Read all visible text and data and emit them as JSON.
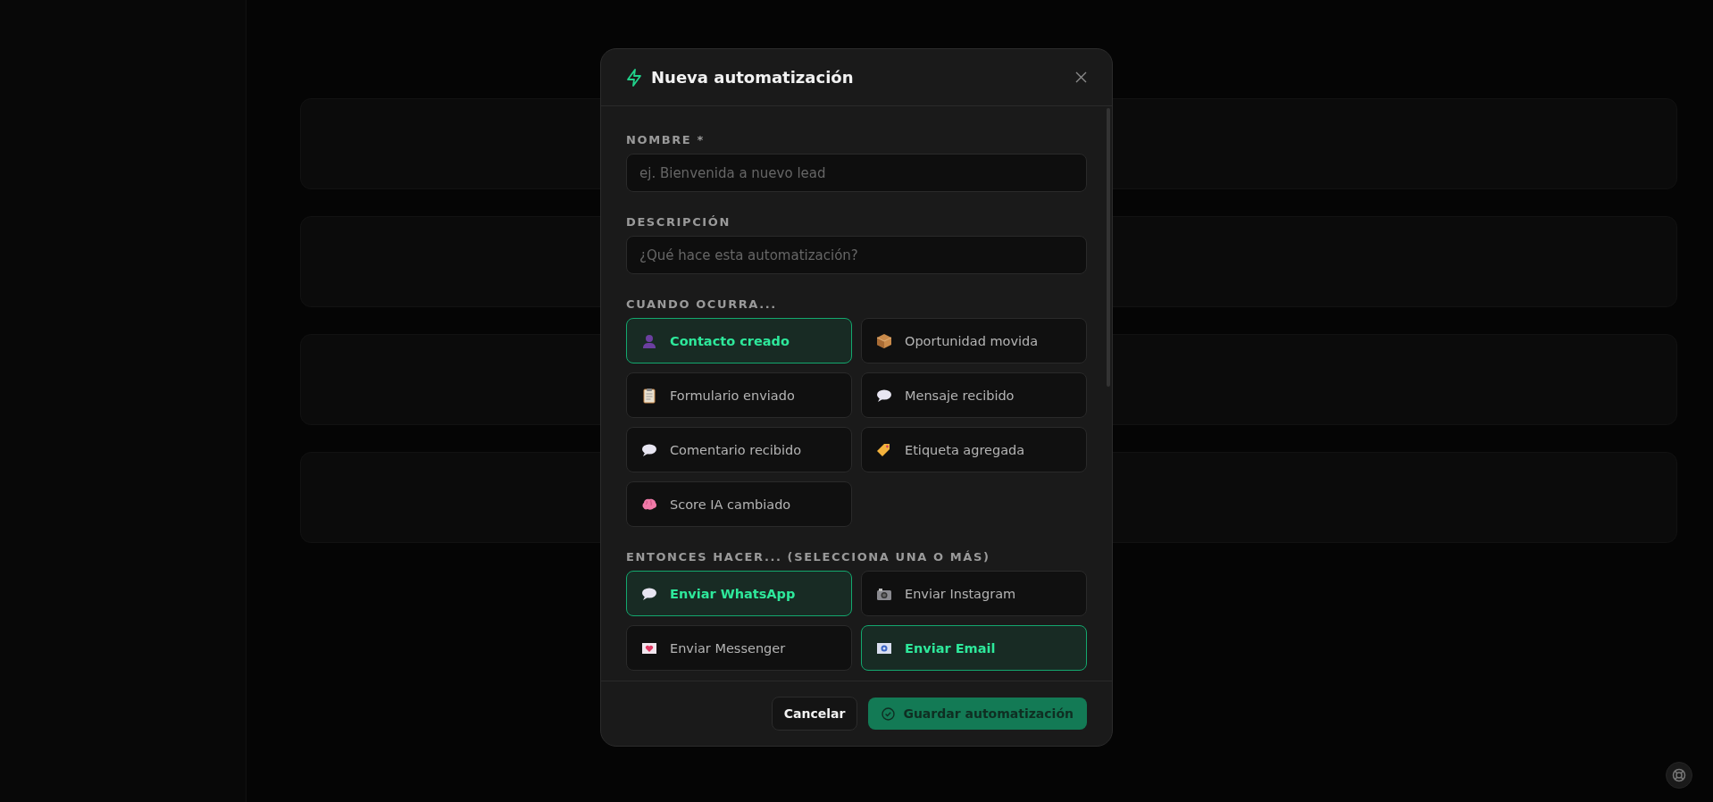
{
  "dialog": {
    "title": "Nueva automatización",
    "fields": [
      {
        "label": "NOMBRE *",
        "placeholder": "ej. Bienvenida a nuevo lead"
      },
      {
        "label": "DESCRIPCIÓN",
        "placeholder": "¿Qué hace esta automatización?"
      }
    ],
    "triggers": {
      "label": "CUANDO OCURRA...",
      "options": [
        {
          "label": "Contacto creado",
          "selected": true
        },
        {
          "label": "Oportunidad movida",
          "selected": false
        },
        {
          "label": "Formulario enviado",
          "selected": false
        },
        {
          "label": "Mensaje recibido",
          "selected": false
        },
        {
          "label": "Comentario recibido",
          "selected": false
        },
        {
          "label": "Etiqueta agregada",
          "selected": false
        },
        {
          "label": "Score IA cambiado",
          "selected": false
        }
      ]
    },
    "actions": {
      "label": "ENTONCES HACER... (SELECCIONA UNA O MÁS)",
      "options": [
        {
          "label": "Enviar WhatsApp",
          "selected": true
        },
        {
          "label": "Enviar Instagram",
          "selected": false
        },
        {
          "label": "Enviar Messenger",
          "selected": false
        },
        {
          "label": "Enviar Email",
          "selected": true
        }
      ]
    },
    "buttons": {
      "cancel": "Cancelar",
      "save": "Guardar automatización"
    }
  }
}
